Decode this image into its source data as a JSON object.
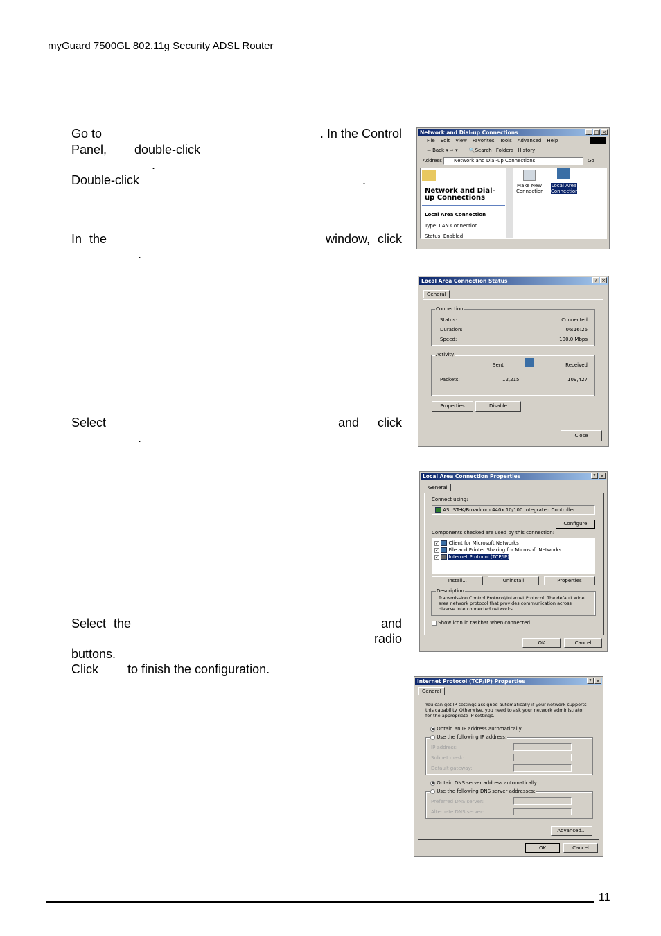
{
  "header": {
    "title": "myGuard 7500GL 802.11g Security ADSL Router"
  },
  "body": {
    "p1": {
      "goto": "Go to",
      "incontrol": ". In the Control",
      "panel": "Panel,",
      "dblclick": "double-click",
      "dot": ".",
      "dblclick2": "Double-click",
      "dot2": "."
    },
    "p2": {
      "inthe": "In the",
      "windowclick": "window, click",
      "dot": "."
    },
    "p3": {
      "select": "Select",
      "andclick": "and click",
      "dot": "."
    },
    "p4": {
      "selectthe": "Select the",
      "and": "and",
      "radio": "radio",
      "buttons": "buttons.",
      "click": "Click",
      "finish": "to finish the configuration."
    }
  },
  "footer": {
    "page_number": "11"
  },
  "dialogs": {
    "netconn": {
      "title": "Network and Dial-up Connections",
      "menu": [
        "File",
        "Edit",
        "View",
        "Favorites",
        "Tools",
        "Advanced",
        "Help"
      ],
      "toolbar": {
        "back": "Back",
        "search": "Search",
        "folders": "Folders",
        "history": "History"
      },
      "address_label": "Address",
      "address_value": "Network and Dial-up Connections",
      "go": "Go",
      "panel_title": "Network and Dial-up Connections",
      "selected_name": "Local Area Connection",
      "type": "Type: LAN Connection",
      "status": "Status: Enabled",
      "icons": [
        {
          "label": "Make New Connection"
        },
        {
          "label": "Local Area Connection"
        }
      ]
    },
    "status": {
      "title": "Local Area Connection Status",
      "tab": "General",
      "connection_group": "Connection",
      "rows": [
        {
          "label": "Status:",
          "value": "Connected"
        },
        {
          "label": "Duration:",
          "value": "06:16:26"
        },
        {
          "label": "Speed:",
          "value": "100.0 Mbps"
        }
      ],
      "activity_group": "Activity",
      "sent": "Sent",
      "received": "Received",
      "packets_label": "Packets:",
      "packets_sent": "12,215",
      "packets_received": "109,427",
      "properties": "Properties",
      "disable": "Disable",
      "close": "Close"
    },
    "props": {
      "title": "Local Area Connection Properties",
      "tab": "General",
      "connect_using": "Connect using:",
      "adapter": "ASUSTeK/Broadcom 440x 10/100 Integrated Controller",
      "configure": "Configure",
      "components_label": "Components checked are used by this connection:",
      "components": [
        "Client for Microsoft Networks",
        "File and Printer Sharing for Microsoft Networks",
        "Internet Protocol (TCP/IP)"
      ],
      "install": "Install...",
      "uninstall": "Uninstall",
      "properties": "Properties",
      "description_group": "Description",
      "description": "Transmission Control Protocol/Internet Protocol. The default wide area network protocol that provides communication across diverse interconnected networks.",
      "show_icon": "Show icon in taskbar when connected",
      "ok": "OK",
      "cancel": "Cancel"
    },
    "tcpip": {
      "title": "Internet Protocol (TCP/IP) Properties",
      "tab": "General",
      "intro": "You can get IP settings assigned automatically if your network supports this capability. Otherwise, you need to ask your network administrator for the appropriate IP settings.",
      "obtain_ip": "Obtain an IP address automatically",
      "use_ip": "Use the following IP address:",
      "ip_fields": [
        "IP address:",
        "Subnet mask:",
        "Default gateway:"
      ],
      "obtain_dns": "Obtain DNS server address automatically",
      "use_dns": "Use the following DNS server addresses:",
      "dns_fields": [
        "Preferred DNS server:",
        "Alternate DNS server:"
      ],
      "advanced": "Advanced...",
      "ok": "OK",
      "cancel": "Cancel"
    }
  }
}
